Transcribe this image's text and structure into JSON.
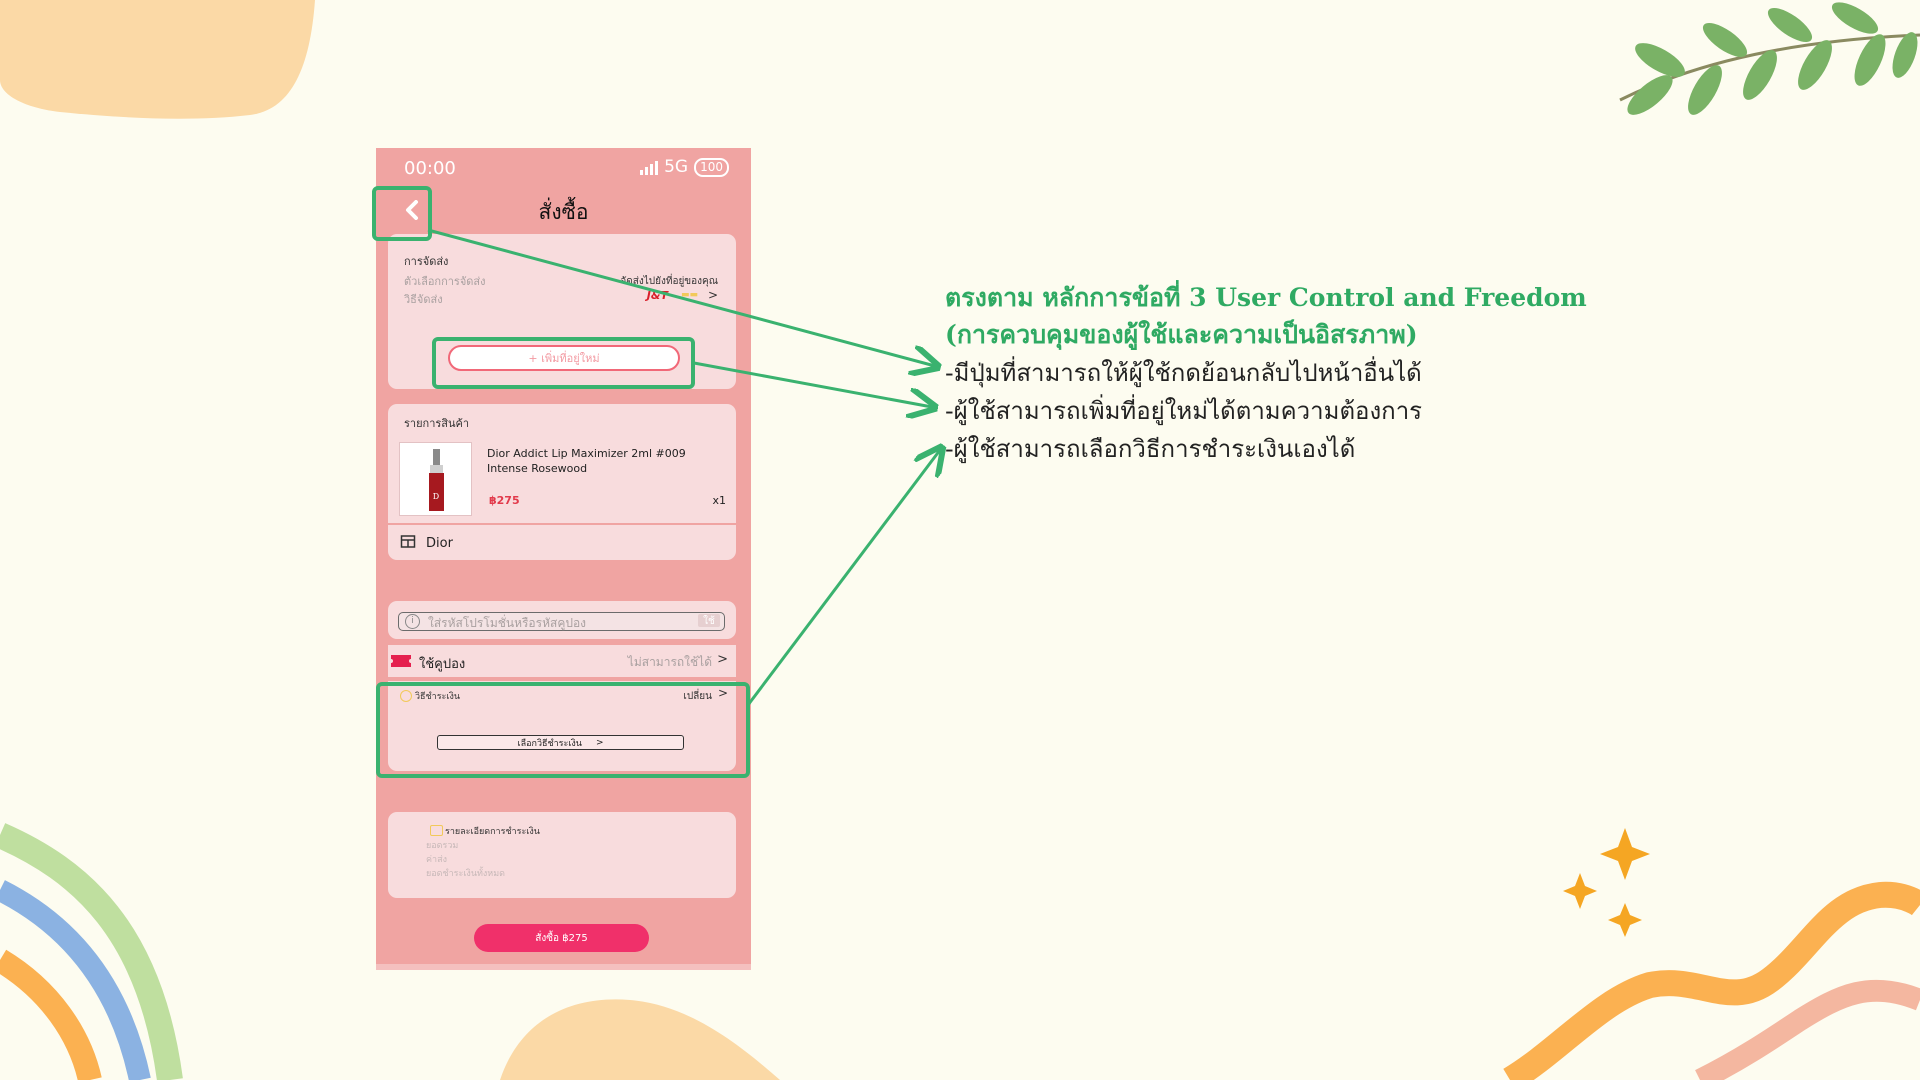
{
  "phone": {
    "status_time": "00:00",
    "network": "5G",
    "battery": "100",
    "title": "สั่งซื้อ",
    "shipping": {
      "title": "การจัดส่ง",
      "option_label": "ตัวเลือกการจัดส่ง",
      "method_label": "วิธีจัดส่ง",
      "deliver_to": "จัดส่งไปยังที่อยู่ของคุณ",
      "carrier": "J&T",
      "add_address": "+ เพิ่มที่อยู่ใหม่"
    },
    "products": {
      "header": "รายการสินค้า",
      "name": "Dior Addict Lip Maximizer 2ml #009 Intense Rosewood",
      "price": "฿275",
      "qty": "x1",
      "shop": "Dior"
    },
    "promo": {
      "placeholder": "ใส่รหัสโปรโมชั่นหรือรหัสคูปอง",
      "apply": "ใช้"
    },
    "coupon": {
      "label": "ใช้คูปอง",
      "status": "ไม่สามารถใช้ได้"
    },
    "payment": {
      "label": "วิธีชำระเงิน",
      "change": "เปลี่ยน",
      "choose": "เลือกวิธีชำระเงิน"
    },
    "summary": {
      "title": "รายละเอียดการชำระเงิน",
      "lines": [
        "ยอดรวม",
        "ค่าส่ง",
        "ยอดชำระเงินทั้งหมด"
      ]
    },
    "order_button": "สั่งซื้อ ฿275"
  },
  "annotation": {
    "title_line1": "ตรงตาม หลักการข้อที่ 3 User Control and Freedom",
    "title_line2": "(การควบคุมของผู้ใช้และความเป็นอิสรภาพ)",
    "points": [
      "-มีปุ่มที่สามารถให้ผู้ใช้กดย้อนกลับไปหน้าอื่นได้",
      "-ผู้ใช้สามารถเพิ่มที่อยู่ใหม่ได้ตามความต้องการ",
      "-ผู้ใช้สามารถเลือกวิธีการชำระเงินเองได้"
    ]
  },
  "colors": {
    "background": "#fdfcf0",
    "phone_bg": "#f0a4a2",
    "card_bg": "#f8dcdd",
    "highlight": "#3ab26f",
    "order_button": "#f0306a",
    "annotation_title": "#2faa63"
  },
  "icons": [
    "back-chevron-icon",
    "signal-icon",
    "battery-icon",
    "shop-icon",
    "coupon-ticket-icon",
    "info-icon",
    "coin-icon",
    "wallet-icon",
    "chevron-right-icon",
    "leaf-branch-icon",
    "sparkle-icon"
  ]
}
